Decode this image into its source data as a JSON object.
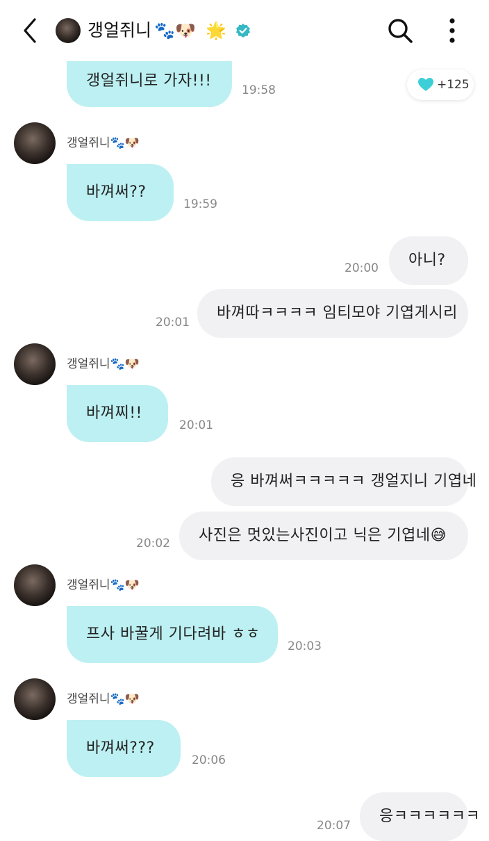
{
  "header": {
    "title": "갱얼쥐니",
    "emojis": [
      "🐾",
      "🐶",
      "🌟"
    ],
    "verified_color": "#35b7c4"
  },
  "like": {
    "count": "+125",
    "heart_color": "#3ccfd8"
  },
  "messages": [
    {
      "side": "in",
      "text": "갱얼쥐니로 가자!!!",
      "time": "19:58"
    },
    {
      "side": "in",
      "sender": "갱얼쥐니🐾🐶",
      "text": "바껴써??",
      "time": "19:59"
    },
    {
      "side": "out",
      "text": "아니?",
      "time": "20:00"
    },
    {
      "side": "out",
      "text": "바껴따ㅋㅋㅋㅋ 임티모야 기엽게시리",
      "time": "20:01"
    },
    {
      "side": "in",
      "sender": "갱얼쥐니🐾🐶",
      "text": "바껴찌!!",
      "time": "20:01"
    },
    {
      "side": "out",
      "text": "응 바껴써ㅋㅋㅋㅋㅋ 갱얼지니 기엽네",
      "time": ""
    },
    {
      "side": "out",
      "text": "사진은 멋있는사진이고 닉은 기엽네😅",
      "time": "20:02"
    },
    {
      "side": "in",
      "sender": "갱얼쥐니🐾🐶",
      "text": "프사 바꿀게 기다려바 ㅎㅎ",
      "time": "20:03"
    },
    {
      "side": "in",
      "sender": "갱얼쥐니🐾🐶",
      "text": "바껴써???",
      "time": "20:06"
    },
    {
      "side": "out",
      "text": "응ㅋㅋㅋㅋㅋㅋ",
      "time": "20:07"
    }
  ],
  "colors": {
    "incoming": "#bdf0f2",
    "outgoing": "#f1f1f4"
  }
}
